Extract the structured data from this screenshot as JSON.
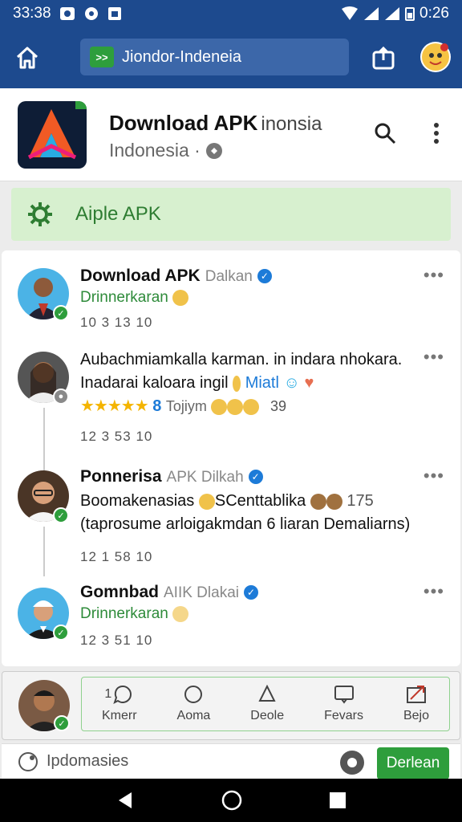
{
  "status": {
    "time": "33:38",
    "battery": "0:26"
  },
  "browser": {
    "url": "Jiondor-Indeneia",
    "favicon_text": ">>"
  },
  "app": {
    "title": "Download APK",
    "title_extra": "inonsia",
    "subtitle": "Indonesia ·"
  },
  "banner": {
    "label": "Aiple APK"
  },
  "posts": [
    {
      "name": "Download APK",
      "name_extra": "Dalkan",
      "sub": "Drinnerkaran",
      "stats": "10 3   13  10"
    },
    {
      "body_line1": "Aubachmiamkalla karman. in indara nhokara.",
      "body_line2": "Inadarai kaloara ingil",
      "body_line2_extra": "Miatl",
      "stars_text": "★★★★★",
      "stars_count": "8",
      "tag": "Tojiym",
      "count": "39",
      "stats": "12 3   53  10"
    },
    {
      "name": "Ponnerisa",
      "name_extra": "APK  Dilkah",
      "body_line1": "Boomakenasias",
      "body_line1_mid": "SCenttablika",
      "body_line1_count": "175",
      "body_line2": "(taprosume arloigakmdan 6 liaran Demaliarns)",
      "stats": "12 1   58  10"
    },
    {
      "name": "Gomnbad",
      "name_extra": "AIIK  Dlakai",
      "sub": "Drinnerkaran",
      "stats": "12 3   51  10"
    }
  ],
  "composer": {
    "prefix": "1",
    "actions": [
      "Kmerr",
      "Aoma",
      "Deole",
      "Fevars",
      "Bejo"
    ]
  },
  "reply": {
    "placeholder": "Ipdomasies",
    "send_label": "Derlean"
  },
  "colors": {
    "primary": "#1d4a8e",
    "accent": "#2e9e3c",
    "banner": "#d7f0cf",
    "verified": "#1d7bd8"
  }
}
